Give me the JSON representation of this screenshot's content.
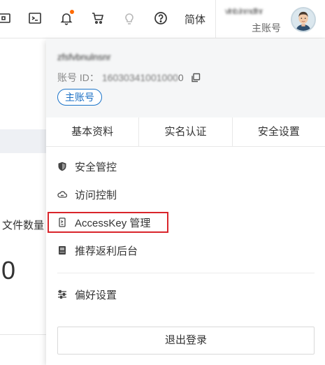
{
  "header": {
    "lang_label": "简体",
    "account_name": "vlnb.lnmdfnr",
    "account_type": "主账号",
    "icons": [
      "app-icon",
      "terminal-icon",
      "bell-icon",
      "cart-icon",
      "lightbulb-icon",
      "help-icon"
    ],
    "notification_dot_color": "#ff6a00"
  },
  "background": {
    "file_count_label": "文件数量",
    "file_count_value": "0"
  },
  "panel": {
    "user_name": "zfsfvbnulnsnr",
    "id_label": "账号 ID：",
    "id_value": "16030341001000",
    "id_suffix": "0",
    "account_badge": "主账号",
    "tabs": [
      {
        "label": "基本资料"
      },
      {
        "label": "实名认证"
      },
      {
        "label": "安全设置"
      }
    ],
    "menu": [
      {
        "label": "安全管控",
        "icon": "shield-icon"
      },
      {
        "label": "访问控制",
        "icon": "cloud-icon"
      },
      {
        "label": "AccessKey 管理",
        "icon": "key-icon",
        "highlighted": true
      },
      {
        "label": "推荐返利后台",
        "icon": "gift-icon"
      },
      {
        "label": "偏好设置",
        "icon": "sliders-icon"
      }
    ],
    "logout_label": "退出登录",
    "highlight_color": "#d9252b",
    "badge_color": "#1a6fc4"
  }
}
